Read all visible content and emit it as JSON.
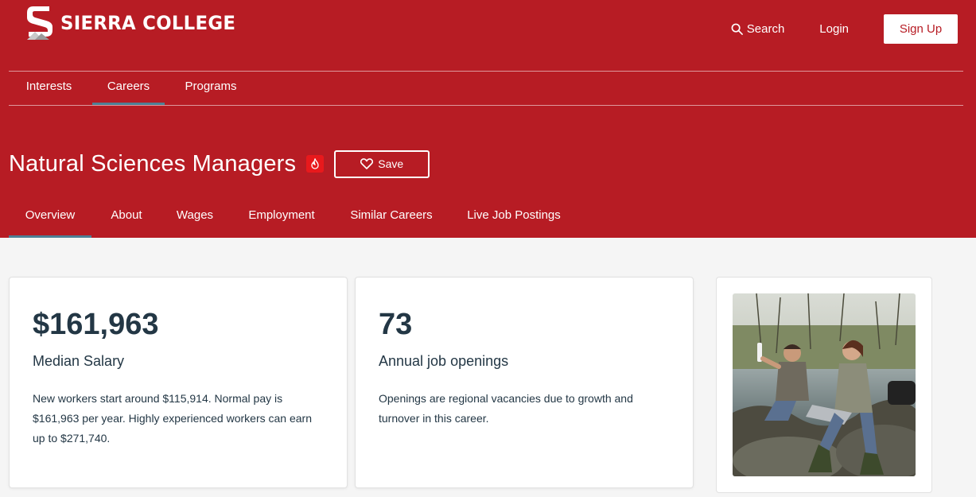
{
  "brand": {
    "name": "SIERRA COLLEGE",
    "primary_color": "#b71c24",
    "accent_color": "#4e7f95"
  },
  "top_actions": {
    "search_label": "Search",
    "login_label": "Login",
    "signup_label": "Sign Up"
  },
  "main_nav": {
    "items": [
      {
        "label": "Interests",
        "active": false
      },
      {
        "label": "Careers",
        "active": true
      },
      {
        "label": "Programs",
        "active": false
      }
    ]
  },
  "career": {
    "title": "Natural Sciences Managers",
    "hot_badge_icon": "fire-icon",
    "save_label": "Save"
  },
  "sub_nav": {
    "items": [
      {
        "label": "Overview",
        "active": true
      },
      {
        "label": "About",
        "active": false
      },
      {
        "label": "Wages",
        "active": false
      },
      {
        "label": "Employment",
        "active": false
      },
      {
        "label": "Similar Careers",
        "active": false
      },
      {
        "label": "Live Job Postings",
        "active": false
      }
    ]
  },
  "salary_card": {
    "value": "$161,963",
    "label": "Median Salary",
    "description": "New workers start around $115,914. Normal pay is $161,963 per year. Highly experienced workers can earn up to $271,740."
  },
  "openings_card": {
    "value": "73",
    "label": "Annual job openings",
    "description": "Openings are regional vacancies due to growth and turnover in this career."
  },
  "photo_card": {
    "image_icon": "scientists-field-photo"
  }
}
